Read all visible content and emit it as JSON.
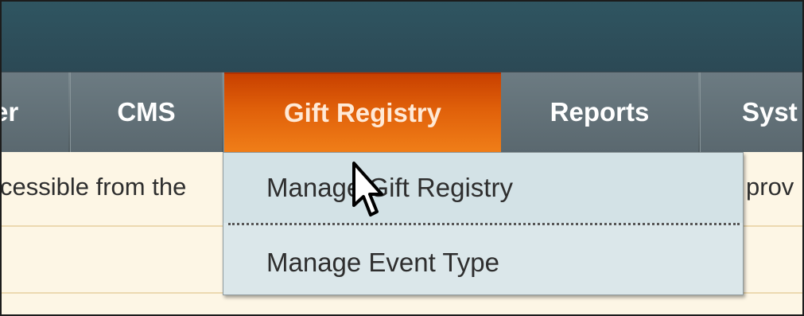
{
  "nav": {
    "items": [
      {
        "label": "er",
        "state": "normal"
      },
      {
        "label": "CMS",
        "state": "normal"
      },
      {
        "label": "Gift Registry",
        "state": "active"
      },
      {
        "label": "Reports",
        "state": "normal"
      },
      {
        "label": "Syst",
        "state": "normal"
      }
    ]
  },
  "dropdown": {
    "items": [
      {
        "label": "Manage Gift Registry"
      },
      {
        "label": "Manage Event Type"
      }
    ]
  },
  "content": {
    "row1_left": "cessible from the",
    "row1_right": "prov"
  },
  "colors": {
    "header": "#2f5561",
    "nav_bar": "#637278",
    "active_tab": "#e0600a",
    "dropdown_bg": "#dbe7ea",
    "content_bg": "#fdf6e5"
  },
  "icons": {
    "cursor": "mouse-pointer-icon"
  }
}
